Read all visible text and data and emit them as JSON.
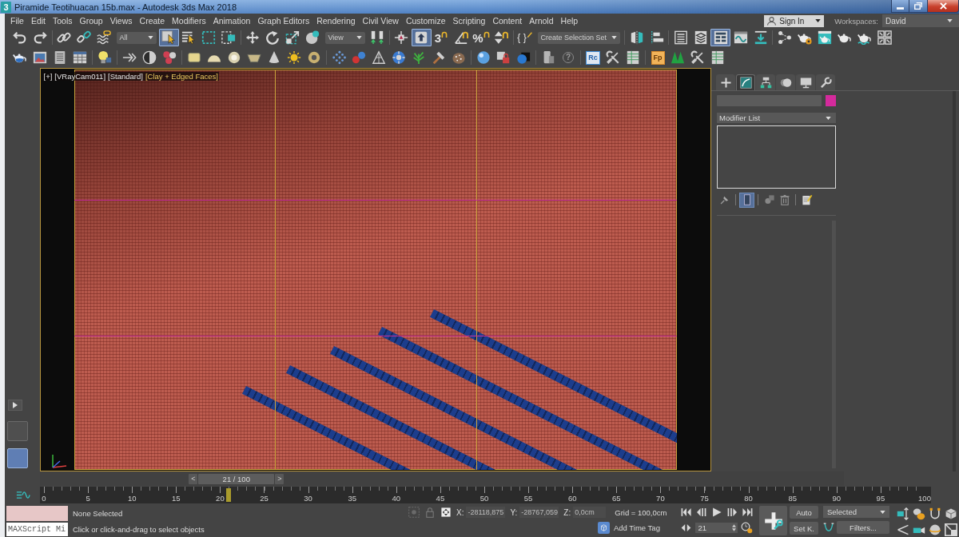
{
  "title_bar": {
    "app_icon": "3",
    "title": "Piramide Teotihuacan 15b.max - Autodesk 3ds Max 2018"
  },
  "menu_bar": {
    "items": [
      "File",
      "Edit",
      "Tools",
      "Group",
      "Views",
      "Create",
      "Modifiers",
      "Animation",
      "Graph Editors",
      "Rendering",
      "Civil View",
      "Customize",
      "Scripting",
      "Content",
      "Arnold",
      "Help"
    ],
    "sign_in": "Sign In",
    "workspaces_label": "Workspaces:",
    "workspace": "David"
  },
  "main_toolbar": [
    [
      {
        "kind": "undo",
        "on": false
      },
      {
        "kind": "redo",
        "on": false
      }
    ],
    [
      {
        "kind": "link",
        "on": false
      },
      {
        "kind": "unlink",
        "on": false
      },
      {
        "kind": "bind",
        "on": false
      },
      {
        "kind": "dropdown",
        "value": "All"
      },
      {
        "kind": "select",
        "on": true
      },
      {
        "kind": "selectname",
        "on": false
      },
      {
        "kind": "region",
        "on": false
      },
      {
        "kind": "crossing",
        "on": false
      }
    ],
    [
      {
        "kind": "move",
        "on": false
      },
      {
        "kind": "rotate",
        "on": false
      },
      {
        "kind": "scale",
        "on": false
      },
      {
        "kind": "place",
        "on": false
      },
      {
        "kind": "dropdown",
        "value": "View"
      },
      {
        "kind": "pivot",
        "on": false
      }
    ],
    [
      {
        "kind": "manipulate",
        "on": false
      },
      {
        "kind": "shortcut",
        "on": true
      },
      {
        "kind": "snap",
        "glyph": "3",
        "on": false
      },
      {
        "kind": "angle",
        "on": false
      },
      {
        "kind": "percent",
        "glyph": "%",
        "on": false
      },
      {
        "kind": "spinner",
        "on": false
      }
    ],
    [
      {
        "kind": "named",
        "glyph": "{ }",
        "on": false
      },
      {
        "kind": "dropdown",
        "value": "Create Selection Set"
      }
    ],
    [
      {
        "kind": "mirror",
        "on": false
      },
      {
        "kind": "align",
        "on": false
      }
    ],
    [
      {
        "kind": "explorer",
        "on": false
      },
      {
        "kind": "layers",
        "on": false
      },
      {
        "kind": "ribbon",
        "on": true
      },
      {
        "kind": "curve",
        "on": false
      },
      {
        "kind": "tray",
        "on": false
      }
    ],
    [
      {
        "kind": "schematic",
        "on": false
      },
      {
        "kind": "rendersetup",
        "on": false
      },
      {
        "kind": "framewindow",
        "on": false
      },
      {
        "kind": "render",
        "on": false
      },
      {
        "kind": "activeshade",
        "on": false
      },
      {
        "kind": "grid",
        "on": false
      }
    ]
  ],
  "secondary_toolbar": [
    [
      {
        "kind": "teapot"
      },
      {
        "kind": "picture"
      },
      {
        "kind": "document"
      },
      {
        "kind": "spreadsheet"
      }
    ],
    [
      {
        "kind": "bulb"
      }
    ],
    [
      {
        "kind": "arrows"
      },
      {
        "kind": "halfcircle"
      },
      {
        "kind": "circles"
      }
    ],
    [
      {
        "kind": "roundsquare"
      },
      {
        "kind": "dome"
      },
      {
        "kind": "ring"
      },
      {
        "kind": "bowl"
      },
      {
        "kind": "cone"
      },
      {
        "kind": "sun"
      },
      {
        "kind": "donut"
      }
    ],
    [
      {
        "kind": "particles"
      },
      {
        "kind": "molecule"
      },
      {
        "kind": "pyramid"
      },
      {
        "kind": "gearball"
      },
      {
        "kind": "plant"
      },
      {
        "kind": "hammer"
      },
      {
        "kind": "stone"
      }
    ],
    [
      {
        "kind": "sphere"
      },
      {
        "kind": "cubelock"
      },
      {
        "kind": "ballsquare"
      }
    ],
    [
      {
        "kind": "device"
      },
      {
        "kind": "help",
        "glyph": "?"
      }
    ],
    [
      {
        "kind": "rc",
        "glyph": "Rc"
      },
      {
        "kind": "tools"
      },
      {
        "kind": "table"
      }
    ],
    [
      {
        "kind": "fp",
        "glyph": "Fp"
      },
      {
        "kind": "trees"
      },
      {
        "kind": "tools"
      },
      {
        "kind": "table"
      }
    ]
  ],
  "viewport_layout_tabs": [
    {
      "selected": false
    },
    {
      "selected": true
    }
  ],
  "viewport": {
    "labels": [
      {
        "text": "[+]",
        "highlighted": false
      },
      {
        "text": "[VRayCam011]",
        "highlighted": false
      },
      {
        "text": "[Standard]",
        "highlighted": false
      },
      {
        "text": "[Clay + Edged Faces]",
        "highlighted": true
      }
    ]
  },
  "command_panel": {
    "tabs": [
      {
        "kind": "create",
        "selected": false
      },
      {
        "kind": "modify",
        "selected": true
      },
      {
        "kind": "hierarchy",
        "selected": false
      },
      {
        "kind": "motion",
        "selected": false
      },
      {
        "kind": "display",
        "selected": false
      },
      {
        "kind": "utilities",
        "selected": false
      }
    ],
    "object_swatch": {
      "color": "#d42a9c"
    },
    "modifier_list": "Modifier List",
    "stack_buttons": [
      [
        {
          "kind": "pin",
          "on": false
        }
      ],
      [
        {
          "kind": "endresult",
          "on": true
        }
      ],
      [
        {
          "kind": "unique",
          "on": false
        },
        {
          "kind": "remove",
          "on": false
        }
      ],
      [
        {
          "kind": "configure",
          "on": false
        }
      ]
    ]
  },
  "time_slider": {
    "prev": "<",
    "reading": "21 / 100",
    "next": ">",
    "level": 0.21
  },
  "track_bar": {
    "ticks": [
      "0",
      "5",
      "10",
      "15",
      "20",
      "25",
      "30",
      "35",
      "40",
      "45",
      "50",
      "55",
      "60",
      "65",
      "70",
      "75",
      "80",
      "85",
      "90",
      "95",
      "100"
    ]
  },
  "status_bar": {
    "listener": "MAXScript Mi",
    "selection": "None Selected",
    "prompt": "Click or click-and-drag to select objects",
    "coordinates": [
      {
        "label": "X:",
        "value": "-28118,875",
        "disabled": true
      },
      {
        "label": "Y:",
        "value": "-28767,059",
        "disabled": true
      },
      {
        "label": "Z:",
        "value": "0,0cm",
        "disabled": true
      }
    ],
    "grid": "Grid = 100,0cm",
    "time_tag": "Add Time Tag",
    "frame": "21",
    "auto_key": {
      "label": "Auto",
      "on": false
    },
    "set_key": "Set K.",
    "key_filter": "Selected",
    "filters": "Filters..."
  }
}
